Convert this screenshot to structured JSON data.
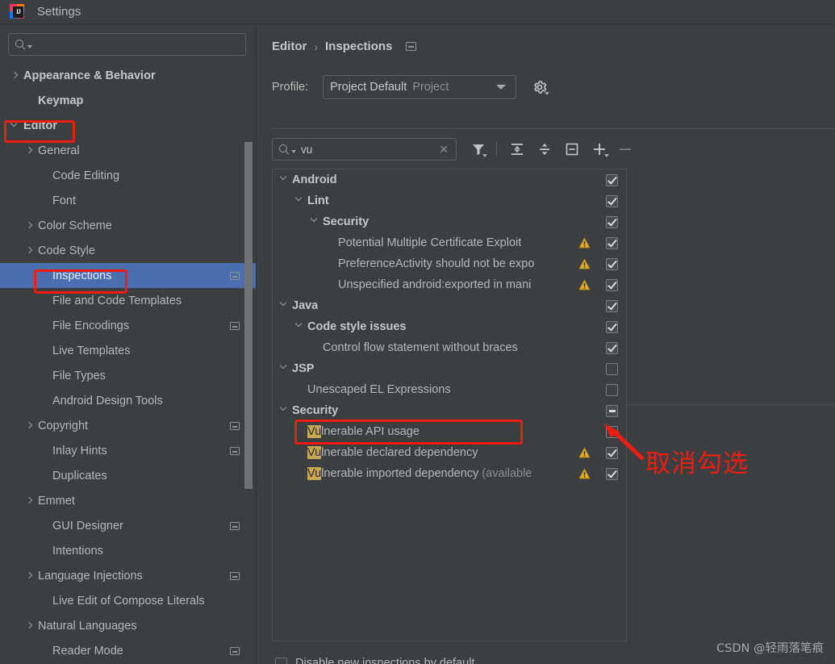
{
  "window": {
    "title": "Settings",
    "app_icon": "intellij-idea-logo"
  },
  "sidebar": {
    "search": {
      "value": "",
      "placeholder": "",
      "icon": "search-icon"
    },
    "items": [
      {
        "label": "Appearance & Behavior",
        "arrow": "right",
        "indent": 0,
        "bold": true,
        "selected": false,
        "config_mark": false
      },
      {
        "label": "Keymap",
        "arrow": "none",
        "indent": 1,
        "bold": true,
        "selected": false,
        "config_mark": false
      },
      {
        "label": "Editor",
        "arrow": "down",
        "indent": 0,
        "bold": true,
        "selected": false,
        "config_mark": false
      },
      {
        "label": "General",
        "arrow": "right",
        "indent": 1,
        "bold": false,
        "selected": false,
        "config_mark": false
      },
      {
        "label": "Code Editing",
        "arrow": "none",
        "indent": 2,
        "bold": false,
        "selected": false,
        "config_mark": false
      },
      {
        "label": "Font",
        "arrow": "none",
        "indent": 2,
        "bold": false,
        "selected": false,
        "config_mark": false
      },
      {
        "label": "Color Scheme",
        "arrow": "right",
        "indent": 1,
        "bold": false,
        "selected": false,
        "config_mark": false
      },
      {
        "label": "Code Style",
        "arrow": "right",
        "indent": 1,
        "bold": false,
        "selected": false,
        "config_mark": false
      },
      {
        "label": "Inspections",
        "arrow": "none",
        "indent": 2,
        "bold": false,
        "selected": true,
        "config_mark": true
      },
      {
        "label": "File and Code Templates",
        "arrow": "none",
        "indent": 2,
        "bold": false,
        "selected": false,
        "config_mark": false
      },
      {
        "label": "File Encodings",
        "arrow": "none",
        "indent": 2,
        "bold": false,
        "selected": false,
        "config_mark": true
      },
      {
        "label": "Live Templates",
        "arrow": "none",
        "indent": 2,
        "bold": false,
        "selected": false,
        "config_mark": false
      },
      {
        "label": "File Types",
        "arrow": "none",
        "indent": 2,
        "bold": false,
        "selected": false,
        "config_mark": false
      },
      {
        "label": "Android Design Tools",
        "arrow": "none",
        "indent": 2,
        "bold": false,
        "selected": false,
        "config_mark": false
      },
      {
        "label": "Copyright",
        "arrow": "right",
        "indent": 1,
        "bold": false,
        "selected": false,
        "config_mark": true
      },
      {
        "label": "Inlay Hints",
        "arrow": "none",
        "indent": 2,
        "bold": false,
        "selected": false,
        "config_mark": true
      },
      {
        "label": "Duplicates",
        "arrow": "none",
        "indent": 2,
        "bold": false,
        "selected": false,
        "config_mark": false
      },
      {
        "label": "Emmet",
        "arrow": "right",
        "indent": 1,
        "bold": false,
        "selected": false,
        "config_mark": false
      },
      {
        "label": "GUI Designer",
        "arrow": "none",
        "indent": 2,
        "bold": false,
        "selected": false,
        "config_mark": true
      },
      {
        "label": "Intentions",
        "arrow": "none",
        "indent": 2,
        "bold": false,
        "selected": false,
        "config_mark": false
      },
      {
        "label": "Language Injections",
        "arrow": "right",
        "indent": 1,
        "bold": false,
        "selected": false,
        "config_mark": true
      },
      {
        "label": "Live Edit of Compose Literals",
        "arrow": "none",
        "indent": 2,
        "bold": false,
        "selected": false,
        "config_mark": false
      },
      {
        "label": "Natural Languages",
        "arrow": "right",
        "indent": 1,
        "bold": false,
        "selected": false,
        "config_mark": false
      },
      {
        "label": "Reader Mode",
        "arrow": "none",
        "indent": 2,
        "bold": false,
        "selected": false,
        "config_mark": true
      }
    ]
  },
  "main": {
    "breadcrumb": {
      "parent": "Editor",
      "separator": "›",
      "current": "Inspections",
      "config_icon": "config-badge-icon"
    },
    "profile": {
      "label": "Profile:",
      "selected_value": "Project Default",
      "scope_suffix": "Project",
      "dropdown_icon": "chevron-down-icon",
      "gear_icon": "gear-icon"
    },
    "filter_bar": {
      "search_value": "vu",
      "search_icon": "search-icon",
      "clear_icon": "close-icon",
      "buttons": [
        {
          "name": "filter-icon",
          "label": "Filter"
        },
        {
          "name": "expand-all-icon",
          "label": "Expand All"
        },
        {
          "name": "collapse-all-icon",
          "label": "Collapse All"
        },
        {
          "name": "reset-icon",
          "label": "Reset"
        },
        {
          "name": "add-icon",
          "label": "Add"
        },
        {
          "name": "remove-icon",
          "label": "Remove"
        }
      ]
    },
    "tree": [
      {
        "label": "Android",
        "indent": 0,
        "arrow": "down",
        "bold": true,
        "checkbox": "checked",
        "warning": false,
        "highlight": ""
      },
      {
        "label": "Lint",
        "indent": 1,
        "arrow": "down",
        "bold": true,
        "checkbox": "checked",
        "warning": false,
        "highlight": ""
      },
      {
        "label": "Security",
        "indent": 2,
        "arrow": "down",
        "bold": true,
        "checkbox": "checked",
        "warning": false,
        "highlight": ""
      },
      {
        "label": "Potential Multiple Certificate Exploit",
        "indent": 3,
        "arrow": "none",
        "bold": false,
        "checkbox": "checked",
        "warning": true,
        "highlight": ""
      },
      {
        "label": "PreferenceActivity should not be expo",
        "indent": 3,
        "arrow": "none",
        "bold": false,
        "checkbox": "checked",
        "warning": true,
        "highlight": ""
      },
      {
        "label": "Unspecified android:exported in mani",
        "indent": 3,
        "arrow": "none",
        "bold": false,
        "checkbox": "checked",
        "warning": true,
        "highlight": ""
      },
      {
        "label": "Java",
        "indent": 0,
        "arrow": "down",
        "bold": true,
        "checkbox": "checked",
        "warning": false,
        "highlight": ""
      },
      {
        "label": "Code style issues",
        "indent": 1,
        "arrow": "down",
        "bold": true,
        "checkbox": "checked",
        "warning": false,
        "highlight": ""
      },
      {
        "label": "Control flow statement without braces",
        "indent": 2,
        "arrow": "none",
        "bold": false,
        "checkbox": "checked",
        "warning": false,
        "highlight": ""
      },
      {
        "label": "JSP",
        "indent": 0,
        "arrow": "down",
        "bold": true,
        "checkbox": "empty",
        "warning": false,
        "highlight": ""
      },
      {
        "label": "Unescaped EL Expressions",
        "indent": 1,
        "arrow": "none",
        "bold": false,
        "checkbox": "empty",
        "warning": false,
        "highlight": ""
      },
      {
        "label": "Security",
        "indent": 0,
        "arrow": "down",
        "bold": true,
        "checkbox": "partial",
        "warning": false,
        "highlight": ""
      },
      {
        "label": "lnerable API usage",
        "indent": 1,
        "arrow": "none",
        "bold": false,
        "checkbox": "empty",
        "warning": false,
        "highlight": "Vu"
      },
      {
        "label": "lnerable declared dependency",
        "indent": 1,
        "arrow": "none",
        "bold": false,
        "checkbox": "checked",
        "warning": true,
        "highlight": "Vu"
      },
      {
        "label": "lnerable imported dependency",
        "indent": 1,
        "arrow": "none",
        "bold": false,
        "checkbox": "checked",
        "warning": true,
        "highlight": "Vu",
        "dim_suffix": " (available"
      }
    ],
    "bottom_checkbox": {
      "label": "Disable new inspections by default",
      "state": "empty"
    }
  },
  "annotations": {
    "uncheck_note": "取消勾选",
    "watermark": "CSDN @轻雨落笔痕",
    "accent_red": "#f01c10",
    "highlight_gold": "#c8a84e",
    "selection_blue": "#4b6eaf"
  }
}
